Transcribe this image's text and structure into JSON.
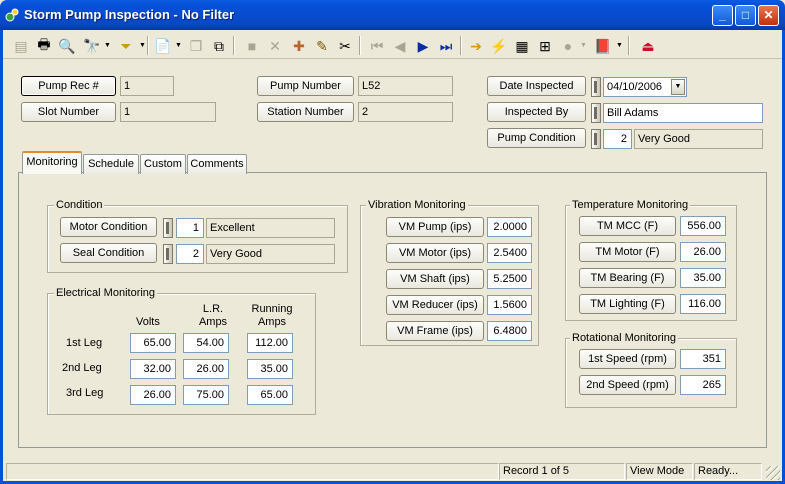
{
  "window": {
    "title": "Storm Pump Inspection - No Filter"
  },
  "header": {
    "pump_rec_label": "Pump Rec #",
    "pump_rec_value": "1",
    "slot_number_label": "Slot Number",
    "slot_number_value": "1",
    "pump_number_label": "Pump Number",
    "pump_number_value": "L52",
    "station_number_label": "Station Number",
    "station_number_value": "2",
    "date_inspected_label": "Date Inspected",
    "date_inspected_value": "04/10/2006",
    "inspected_by_label": "Inspected By",
    "inspected_by_value": "Bill Adams",
    "pump_condition_label": "Pump Condition",
    "pump_condition_code": "2",
    "pump_condition_text": "Very Good"
  },
  "tabs": [
    {
      "label": "Monitoring",
      "active": true
    },
    {
      "label": "Schedule"
    },
    {
      "label": "Custom"
    },
    {
      "label": "Comments"
    }
  ],
  "condition": {
    "title": "Condition",
    "motor_label": "Motor Condition",
    "motor_code": "1",
    "motor_text": "Excellent",
    "seal_label": "Seal Condition",
    "seal_code": "2",
    "seal_text": "Very Good"
  },
  "electrical": {
    "title": "Electrical Monitoring",
    "col_volts": "Volts",
    "col_lr_1": "L.R.",
    "col_lr_2": "Amps",
    "col_run_1": "Running",
    "col_run_2": "Amps",
    "rows": [
      {
        "label": "1st Leg",
        "volts": "65.00",
        "lr": "54.00",
        "run": "112.00"
      },
      {
        "label": "2nd Leg",
        "volts": "32.00",
        "lr": "26.00",
        "run": "35.00"
      },
      {
        "label": "3rd Leg",
        "volts": "26.00",
        "lr": "75.00",
        "run": "65.00"
      }
    ]
  },
  "vibration": {
    "title": "Vibration Monitoring",
    "items": [
      {
        "label": "VM Pump (ips)",
        "value": "2.0000"
      },
      {
        "label": "VM Motor (ips)",
        "value": "2.5400"
      },
      {
        "label": "VM Shaft (ips)",
        "value": "5.2500"
      },
      {
        "label": "VM Reducer (ips)",
        "value": "1.5600"
      },
      {
        "label": "VM Frame (ips)",
        "value": "6.4800"
      }
    ]
  },
  "temperature": {
    "title": "Temperature Monitoring",
    "items": [
      {
        "label": "TM MCC (F)",
        "value": "556.00"
      },
      {
        "label": "TM Motor (F)",
        "value": "26.00"
      },
      {
        "label": "TM Bearing (F)",
        "value": "35.00"
      },
      {
        "label": "TM Lighting (F)",
        "value": "116.00"
      }
    ]
  },
  "rotational": {
    "title": "Rotational Monitoring",
    "items": [
      {
        "label": "1st Speed (rpm)",
        "value": "351"
      },
      {
        "label": "2nd Speed (rpm)",
        "value": "265"
      }
    ]
  },
  "status": {
    "record": "Record 1 of 5",
    "mode": "View Mode",
    "ready": "Ready..."
  },
  "colors": {
    "titlebar": "#0550d8",
    "window_bg": "#ece9d8",
    "tab_accent": "#e68b2c"
  }
}
